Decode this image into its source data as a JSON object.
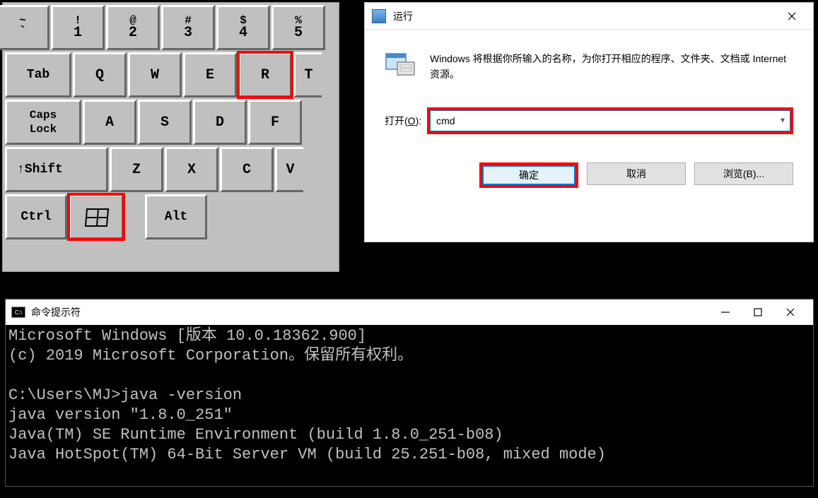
{
  "keyboard": {
    "row1": [
      {
        "upper": "~",
        "lower": "`"
      },
      {
        "upper": "!",
        "lower": "1"
      },
      {
        "upper": "@",
        "lower": "2"
      },
      {
        "upper": "#",
        "lower": "3"
      },
      {
        "upper": "$",
        "lower": "4"
      },
      {
        "upper": "%",
        "lower": "5"
      }
    ],
    "tab": "Tab",
    "row2": [
      "Q",
      "W",
      "E",
      "R",
      "T"
    ],
    "caps_line1": "Caps",
    "caps_line2": "Lock",
    "row3": [
      "A",
      "S",
      "D",
      "F"
    ],
    "shift": "↑Shift",
    "row4": [
      "Z",
      "X",
      "C",
      "V"
    ],
    "ctrl": "Ctrl",
    "alt": "Alt"
  },
  "run_dialog": {
    "title": "运行",
    "description": "Windows 将根据你所输入的名称，为你打开相应的程序、文件夹、文档或 Internet 资源。",
    "open_label_pre": "打开(",
    "open_label_u": "O",
    "open_label_post": "):",
    "input_value": "cmd",
    "btn_ok": "确定",
    "btn_cancel": "取消",
    "btn_browse": "浏览(B)..."
  },
  "cmd": {
    "title": "命令提示符",
    "line1": "Microsoft Windows [版本 10.0.18362.900]",
    "line2": "(c) 2019 Microsoft Corporation。保留所有权利。",
    "line3": "",
    "line4": "C:\\Users\\MJ>java -version",
    "line5": "java version \"1.8.0_251\"",
    "line6": "Java(TM) SE Runtime Environment (build 1.8.0_251-b08)",
    "line7": "Java HotSpot(TM) 64-Bit Server VM (build 25.251-b08, mixed mode)"
  }
}
